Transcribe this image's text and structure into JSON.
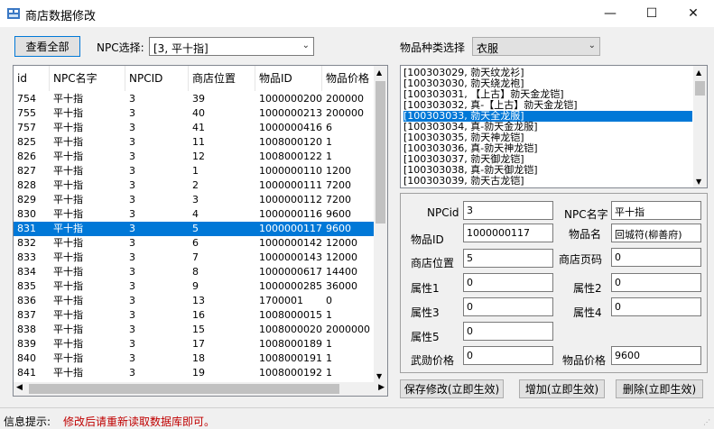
{
  "window": {
    "title": "商店数据修改",
    "minimize": "—",
    "maximize": "☐",
    "close": "✕"
  },
  "toolbar": {
    "view_all": "查看全部",
    "npc_label": "NPC选择:",
    "npc_value": "[3, 平十指]",
    "category_label": "物品种类选择",
    "category_value": "衣服"
  },
  "grid": {
    "columns": [
      "id",
      "NPC名字",
      "NPCID",
      "商店位置",
      "物品ID",
      "物品价格"
    ],
    "rows": [
      [
        "754",
        "平十指",
        "3",
        "39",
        "1000000200",
        "200000"
      ],
      [
        "755",
        "平十指",
        "3",
        "40",
        "1000000213",
        "200000"
      ],
      [
        "757",
        "平十指",
        "3",
        "41",
        "1000000416",
        "6"
      ],
      [
        "825",
        "平十指",
        "3",
        "11",
        "1008000120",
        "1"
      ],
      [
        "826",
        "平十指",
        "3",
        "12",
        "1008000122",
        "1"
      ],
      [
        "827",
        "平十指",
        "3",
        "1",
        "1000000110",
        "1200"
      ],
      [
        "828",
        "平十指",
        "3",
        "2",
        "1000000111",
        "7200"
      ],
      [
        "829",
        "平十指",
        "3",
        "3",
        "1000000112",
        "7200"
      ],
      [
        "830",
        "平十指",
        "3",
        "4",
        "1000000116",
        "9600"
      ],
      [
        "831",
        "平十指",
        "3",
        "5",
        "1000000117",
        "9600"
      ],
      [
        "832",
        "平十指",
        "3",
        "6",
        "1000000142",
        "12000"
      ],
      [
        "833",
        "平十指",
        "3",
        "7",
        "1000000143",
        "12000"
      ],
      [
        "834",
        "平十指",
        "3",
        "8",
        "1000000617",
        "14400"
      ],
      [
        "835",
        "平十指",
        "3",
        "9",
        "1000000285",
        "36000"
      ],
      [
        "836",
        "平十指",
        "3",
        "13",
        "1700001",
        "0"
      ],
      [
        "837",
        "平十指",
        "3",
        "16",
        "1008000015",
        "1"
      ],
      [
        "838",
        "平十指",
        "3",
        "15",
        "1008000020",
        "2000000"
      ],
      [
        "839",
        "平十指",
        "3",
        "17",
        "1008000189",
        "1"
      ],
      [
        "840",
        "平十指",
        "3",
        "18",
        "1008000191",
        "1"
      ],
      [
        "841",
        "平十指",
        "3",
        "19",
        "1008000192",
        "1"
      ]
    ],
    "selected_index": 9
  },
  "item_list": {
    "items": [
      "[100303029, 勍天纹龙衫]",
      "[100303030, 勍天绕龙袍]",
      "[100303031, 【上古】勍天金龙铠]",
      "[100303032, 真-【上古】勍天金龙铠]",
      "[100303033, 勍天全龙服]",
      "[100303034, 真-勍天金龙服]",
      "[100303035, 勍天神龙铠]",
      "[100303036, 真-勍天神龙铠]",
      "[100303037, 勍天御龙铠]",
      "[100303038, 真-勍天御龙铠]",
      "[100303039, 勍天古龙铠]"
    ],
    "selected_index": 4
  },
  "form": {
    "npcid_label": "NPCid",
    "npcid_value": "3",
    "npcname_label": "NPC名字",
    "npcname_value": "平十指",
    "itemid_label": "物品ID",
    "itemid_value": "1000000117",
    "itemname_label": "物品名",
    "itemname_value": "回城符(柳善府)",
    "shoppos_label": "商店位置",
    "shoppos_value": "5",
    "shoppage_label": "商店页码",
    "shoppage_value": "0",
    "attr1_label": "属性1",
    "attr1_value": "0",
    "attr2_label": "属性2",
    "attr2_value": "0",
    "attr3_label": "属性3",
    "attr3_value": "0",
    "attr4_label": "属性4",
    "attr4_value": "0",
    "attr5_label": "属性5",
    "attr5_value": "0",
    "wuxun_label": "武勋价格",
    "wuxun_value": "0",
    "price_label": "物品价格",
    "price_value": "9600"
  },
  "actions": {
    "save": "保存修改(立即生效)",
    "add": "增加(立即生效)",
    "delete": "删除(立即生效)"
  },
  "status": {
    "label": "信息提示:",
    "message": "修改后请重新读取数据库即可。"
  }
}
